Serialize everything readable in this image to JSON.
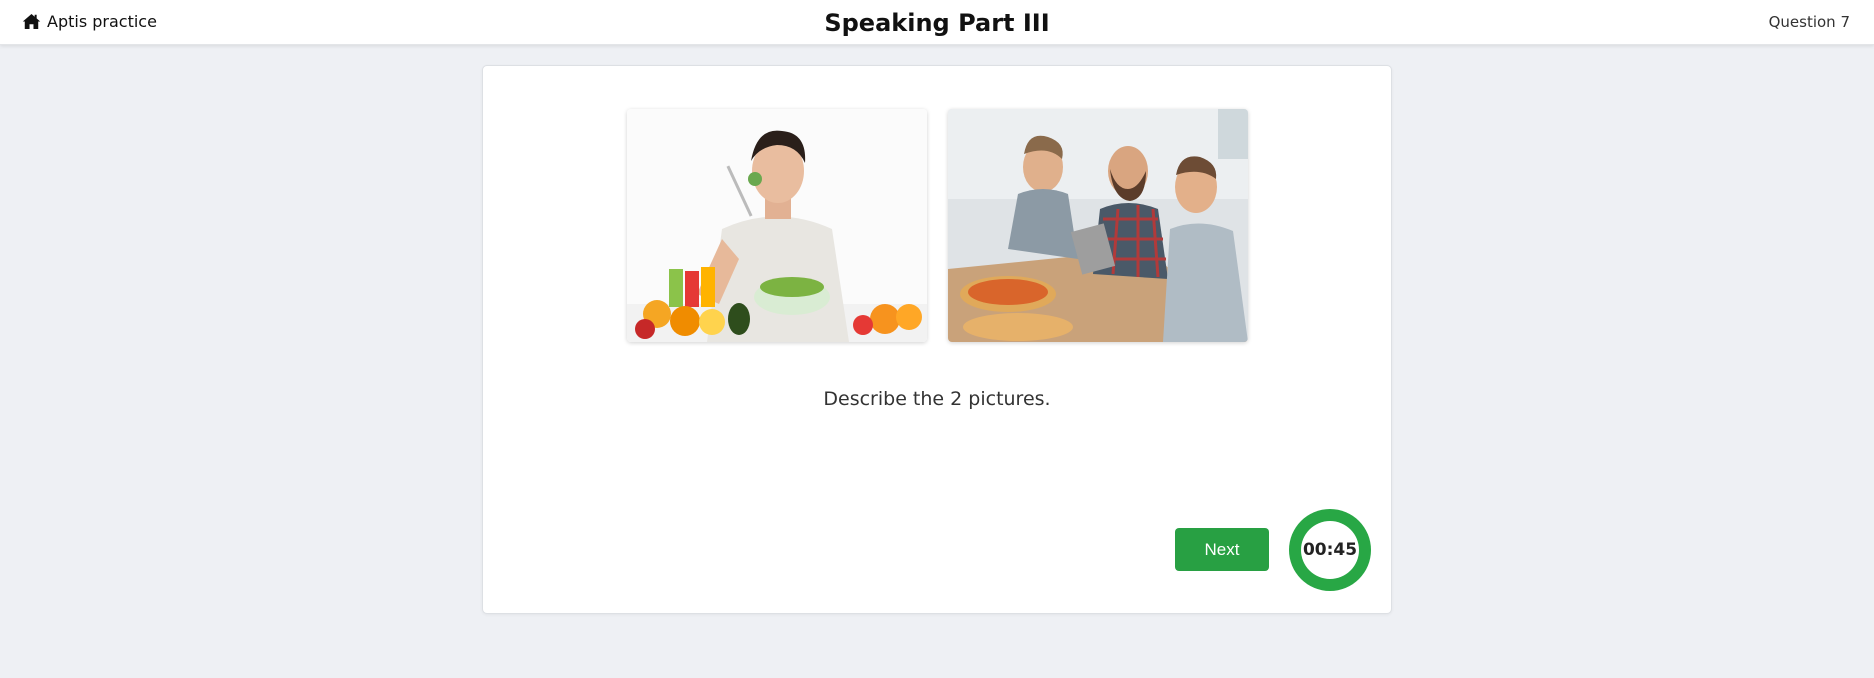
{
  "header": {
    "home_label": "Aptis practice",
    "title": "Speaking Part III",
    "question_label": "Question 7"
  },
  "task": {
    "prompt": "Describe the 2 pictures.",
    "pictures": [
      {
        "icon": "photo-man-eating-salad"
      },
      {
        "icon": "photo-friends-eating-pizza"
      }
    ]
  },
  "actions": {
    "next_label": "Next"
  },
  "timer": {
    "value": "00:45",
    "color": "#28a745"
  },
  "colors": {
    "accent": "#28a745",
    "background": "#eef0f4"
  }
}
